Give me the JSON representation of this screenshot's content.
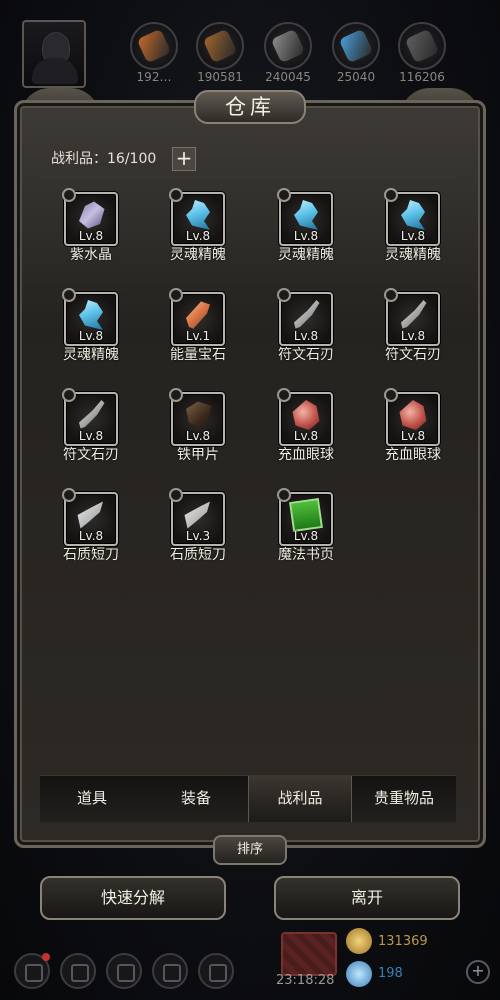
{
  "resources": [
    {
      "icon": "orange-cloth-icon",
      "value": "192…",
      "color": "#c46a2c"
    },
    {
      "icon": "leather-icon",
      "value": "190581",
      "color": "#a0652c"
    },
    {
      "icon": "iron-ingot-icon",
      "value": "240045",
      "color": "#8c8c8c"
    },
    {
      "icon": "blue-gem-icon",
      "value": "25040",
      "color": "#4a9fd8"
    },
    {
      "icon": "stone-icon",
      "value": "116206",
      "color": "#5f5f5f"
    }
  ],
  "panel": {
    "title": "仓库",
    "loot_label": "战利品：16/100",
    "add_symbol": "+"
  },
  "items": [
    {
      "name": "紫水晶",
      "level": "Lv.8",
      "icon": "amethyst-icon",
      "locked": true
    },
    {
      "name": "灵魂精魄",
      "level": "Lv.8",
      "icon": "soul-essence-icon",
      "locked": true
    },
    {
      "name": "灵魂精魄",
      "level": "Lv.8",
      "icon": "soul-essence-icon",
      "locked": true
    },
    {
      "name": "灵魂精魄",
      "level": "Lv.8",
      "icon": "soul-essence-icon",
      "locked": true
    },
    {
      "name": "灵魂精魄",
      "level": "Lv.8",
      "icon": "soul-essence-icon",
      "locked": true
    },
    {
      "name": "能量宝石",
      "level": "Lv.1",
      "icon": "energy-gem-icon",
      "locked": true
    },
    {
      "name": "符文石刃",
      "level": "Lv.8",
      "icon": "rune-blade-icon",
      "locked": true
    },
    {
      "name": "符文石刃",
      "level": "Lv.8",
      "icon": "rune-blade-icon",
      "locked": true
    },
    {
      "name": "符文石刃",
      "level": "Lv.8",
      "icon": "rune-blade-icon",
      "locked": true
    },
    {
      "name": "铁甲片",
      "level": "Lv.8",
      "icon": "iron-plate-icon",
      "locked": true
    },
    {
      "name": "充血眼球",
      "level": "Lv.8",
      "icon": "bloodshot-eye-icon",
      "locked": true
    },
    {
      "name": "充血眼球",
      "level": "Lv.8",
      "icon": "bloodshot-eye-icon",
      "locked": true
    },
    {
      "name": "石质短刀",
      "level": "Lv.8",
      "icon": "stone-knife-icon",
      "locked": true
    },
    {
      "name": "石质短刀",
      "level": "Lv.3",
      "icon": "stone-knife-icon",
      "locked": true
    },
    {
      "name": "魔法书页",
      "level": "Lv.8",
      "icon": "magic-page-icon",
      "locked": true
    }
  ],
  "tabs": [
    {
      "label": "道具",
      "active": false
    },
    {
      "label": "装备",
      "active": false
    },
    {
      "label": "战利品",
      "active": true
    },
    {
      "label": "贵重物品",
      "active": false
    }
  ],
  "buttons": {
    "sort": "排序",
    "quick_dismantle": "快速分解",
    "leave": "离开"
  },
  "footer": {
    "time": "23:18:28",
    "gold": "131369",
    "gems": "198",
    "gold_color": "#b89a4a",
    "gem_color": "#3b7fb6"
  }
}
